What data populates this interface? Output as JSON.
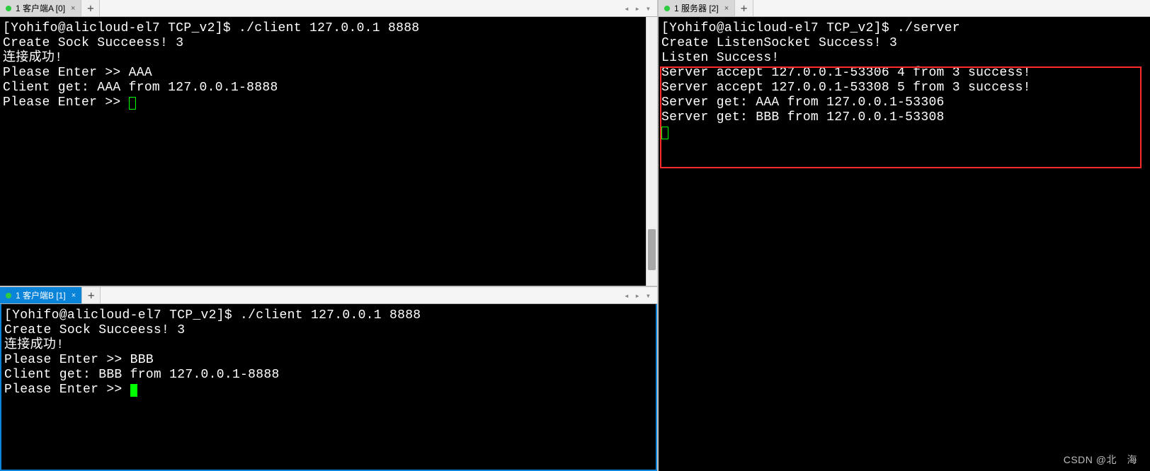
{
  "panes": {
    "clientA": {
      "tab_label": "1 客户端A [0]",
      "lines": {
        "l0": "[Yohifo@alicloud-el7 TCP_v2]$ ./client 127.0.0.1 8888",
        "l1": "Create Sock Succeess! 3",
        "l2": "连接成功!",
        "l3": "Please Enter >> AAA",
        "l4": "Client get: AAA from 127.0.0.1-8888",
        "l5": "Please Enter >> "
      }
    },
    "clientB": {
      "tab_label": "1 客户端B [1]",
      "lines": {
        "l0": "[Yohifo@alicloud-el7 TCP_v2]$ ./client 127.0.0.1 8888",
        "l1": "Create Sock Succeess! 3",
        "l2": "连接成功!",
        "l3": "Please Enter >> BBB",
        "l4": "Client get: BBB from 127.0.0.1-8888",
        "l5": "Please Enter >> "
      }
    },
    "server": {
      "tab_label": "1 服务器 [2]",
      "lines": {
        "l0": "[Yohifo@alicloud-el7 TCP_v2]$ ./server",
        "l1": "Create ListenSocket Success! 3",
        "l2": "Listen Success!",
        "l3": "Server accept 127.0.0.1-53306 4 from 3 success!",
        "l4": "Server accept 127.0.0.1-53308 5 from 3 success!",
        "l5": "Server get: AAA from 127.0.0.1-53306",
        "l6": "Server get: BBB from 127.0.0.1-53308"
      }
    }
  },
  "icons": {
    "add": "+",
    "close": "×",
    "left": "◂",
    "right": "▸",
    "menu": "▾"
  },
  "watermark": "CSDN @北　海"
}
